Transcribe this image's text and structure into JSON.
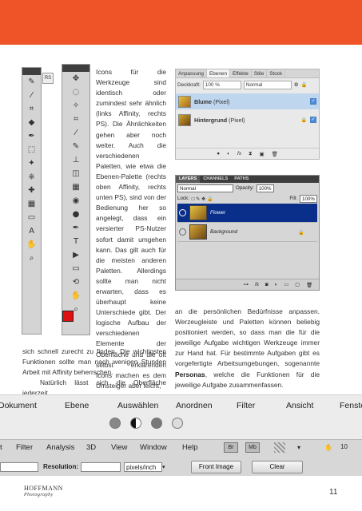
{
  "colors": {
    "accent": "#ee5428",
    "ps_selection": "#0a2f8a",
    "affinity_selection": "#bfd6ef"
  },
  "toolbar_left": [
    "brush-tool",
    "eyedropper-tool",
    "crop-tool",
    "paint-tool",
    "pen-tool",
    "marquee-tool",
    "wand-tool",
    "clone-tool",
    "healing-tool",
    "gradient-tool",
    "shape-tool",
    "text-tool",
    "hand-tool",
    "zoom-tool"
  ],
  "toolbar_right": [
    "move-tool",
    "lasso-tool",
    "magic-tool",
    "crop-tool",
    "eyedropper-tool",
    "brush-tool",
    "stamp-tool",
    "eraser-tool",
    "gradient-tool",
    "blur-tool",
    "dodge-tool",
    "pen-tool",
    "type-tool",
    "select-tool",
    "shape-tool",
    "rotate-tool",
    "hand-tool",
    "zoom-tool"
  ],
  "toolbar_tab": "RS",
  "text": {
    "col_narrow": "Icons für die Werkzeuge sind identisch oder zumindest sehr ähnlich (links Affinity, rechts PS). Die Ähnlichkeiten gehen aber noch weiter. Auch die verschiedenen Paletten, wie etwa die Ebenen-Palette (rechts oben Affinity, rechts unten PS), sind von der Bedienung her so angelegt, dass ein versierter PS-Nutzer sofort damit umgehen kann. Das gilt auch für die meisten anderen Paletten. Allerdings sollte man nicht erwarten, dass es überhaupt keine Unterschiede gibt. Der logische Aufbau der verschiedenen Elemente der Oberfläche und die oft selbst erklärenden Icons machen es dem Umsteiger aber leicht,",
    "col_full_1": "sich schnell zurecht zu finden. Die wichtigsten Funktionen sollte man nach wenigen Stunden Arbeit mit Affinity beherrschen.",
    "col_full_2": "Natürlich lässt sich die Oberfläche jederzeit",
    "col_right_1": "an die persönlichen Bedürfnisse anpassen. Werzeugleiste und Paletten können beliebig positioniert werden, so dass man die für die jeweilige Aufgabe wichtigen Werkzeuge immer zur Hand hat. Für bestimmte Aufgaben gibt es vorgefertigte Arbeitsumgebungen, sogenannte ",
    "col_right_bold": "Personas",
    "col_right_2": ", welche die Funktionen für die jeweilige Aufgabe zusammenfassen."
  },
  "affinity_panel": {
    "tabs": [
      "Anpassung",
      "Ebenen",
      "Effekte",
      "Stile",
      "Stock"
    ],
    "active_tab": "Ebenen",
    "opacity_label": "Deckkraft:",
    "opacity_value": "100 %",
    "blend_mode": "Normal",
    "layers": [
      {
        "name": "Blume",
        "suffix": "(Pixel)",
        "selected": true
      },
      {
        "name": "Hintergrund",
        "suffix": "(Pixel)",
        "selected": false
      }
    ]
  },
  "ps_panel": {
    "tabs": [
      "LAYERS",
      "CHANNELS",
      "PATHS"
    ],
    "blend_mode": "Normal",
    "opacity_label": "Opacity:",
    "opacity_value": "100%",
    "lock_label": "Lock:",
    "fill_label": "Fill:",
    "fill_value": "100%",
    "layers": [
      {
        "name": "Flower",
        "selected": true
      },
      {
        "name": "Background",
        "selected": false
      }
    ]
  },
  "menu_affinity": [
    "Dokument",
    "Ebene",
    "Auswählen",
    "Anordnen",
    "Filter",
    "Ansicht",
    "Fenster"
  ],
  "menu_ps": [
    "t",
    "Filter",
    "Analysis",
    "3D",
    "View",
    "Window",
    "Help"
  ],
  "menu_ps_badges": [
    "Br",
    "Mb"
  ],
  "ps_options": {
    "resolution_label": "Resolution:",
    "unit": "pixels/inch",
    "front_image": "Front Image",
    "clear": "Clear",
    "zoom_value": "10"
  },
  "footer": {
    "logo_main": "HOFFMANN",
    "logo_sub": "Photography",
    "page_number": "11"
  }
}
